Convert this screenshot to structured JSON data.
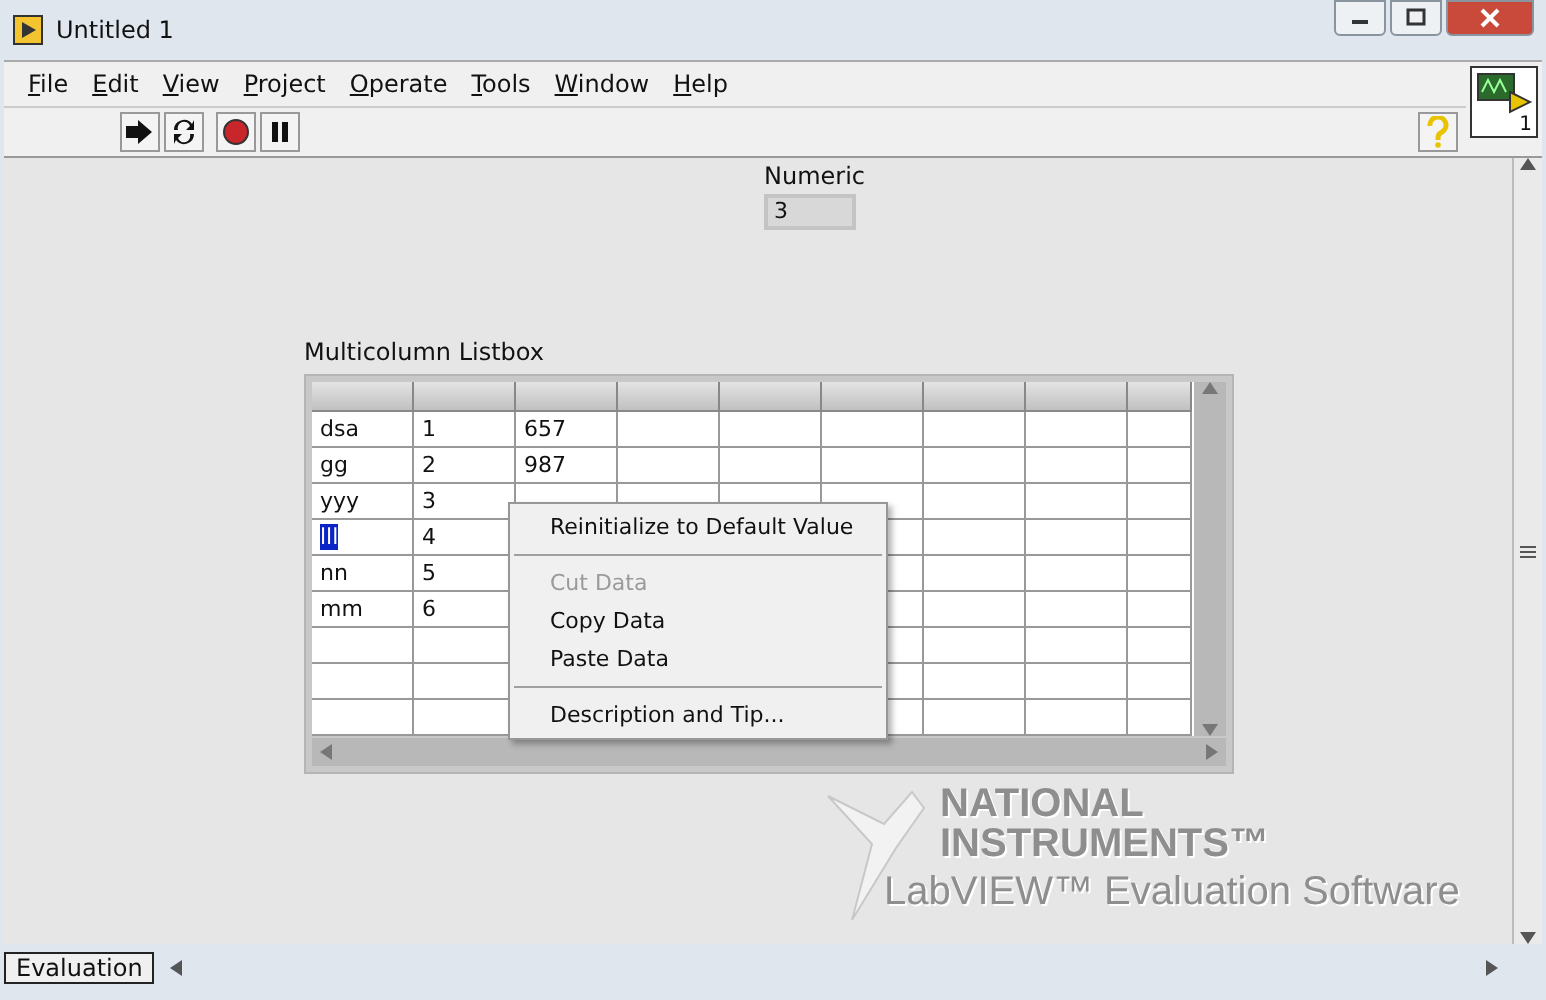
{
  "window": {
    "title": "Untitled 1"
  },
  "menu": [
    {
      "label": "File"
    },
    {
      "label": "Edit"
    },
    {
      "label": "View"
    },
    {
      "label": "Project"
    },
    {
      "label": "Operate"
    },
    {
      "label": "Tools"
    },
    {
      "label": "Window"
    },
    {
      "label": "Help"
    }
  ],
  "connector_pane": {
    "number": "1"
  },
  "numeric": {
    "label": "Numeric",
    "value": "3"
  },
  "listbox": {
    "label": "Multicolumn Listbox",
    "rows": [
      {
        "cells": [
          "dsa",
          "1",
          "657"
        ],
        "selected": false
      },
      {
        "cells": [
          "gg",
          "2",
          "987"
        ],
        "selected": false
      },
      {
        "cells": [
          "yyy",
          "3"
        ],
        "selected": false
      },
      {
        "cells": [
          "lll",
          "4"
        ],
        "selected": true
      },
      {
        "cells": [
          "nn",
          "5"
        ],
        "selected": false
      },
      {
        "cells": [
          "mm",
          "6"
        ],
        "selected": false
      }
    ]
  },
  "context_menu": [
    {
      "kind": "item",
      "label": "Reinitialize to Default Value",
      "disabled": false
    },
    {
      "kind": "separator"
    },
    {
      "kind": "item",
      "label": "Cut Data",
      "disabled": true
    },
    {
      "kind": "item",
      "label": "Copy Data",
      "disabled": false
    },
    {
      "kind": "item",
      "label": "Paste Data",
      "disabled": false
    },
    {
      "kind": "separator"
    },
    {
      "kind": "item",
      "label": "Description and Tip...",
      "disabled": false
    }
  ],
  "evaluation_banner": {
    "line_1": "NATIONAL",
    "line_2": "INSTRUMENTS™",
    "line_3": "LabVIEW™ Evaluation Software"
  },
  "status_bar": {
    "label": "Evaluation"
  }
}
